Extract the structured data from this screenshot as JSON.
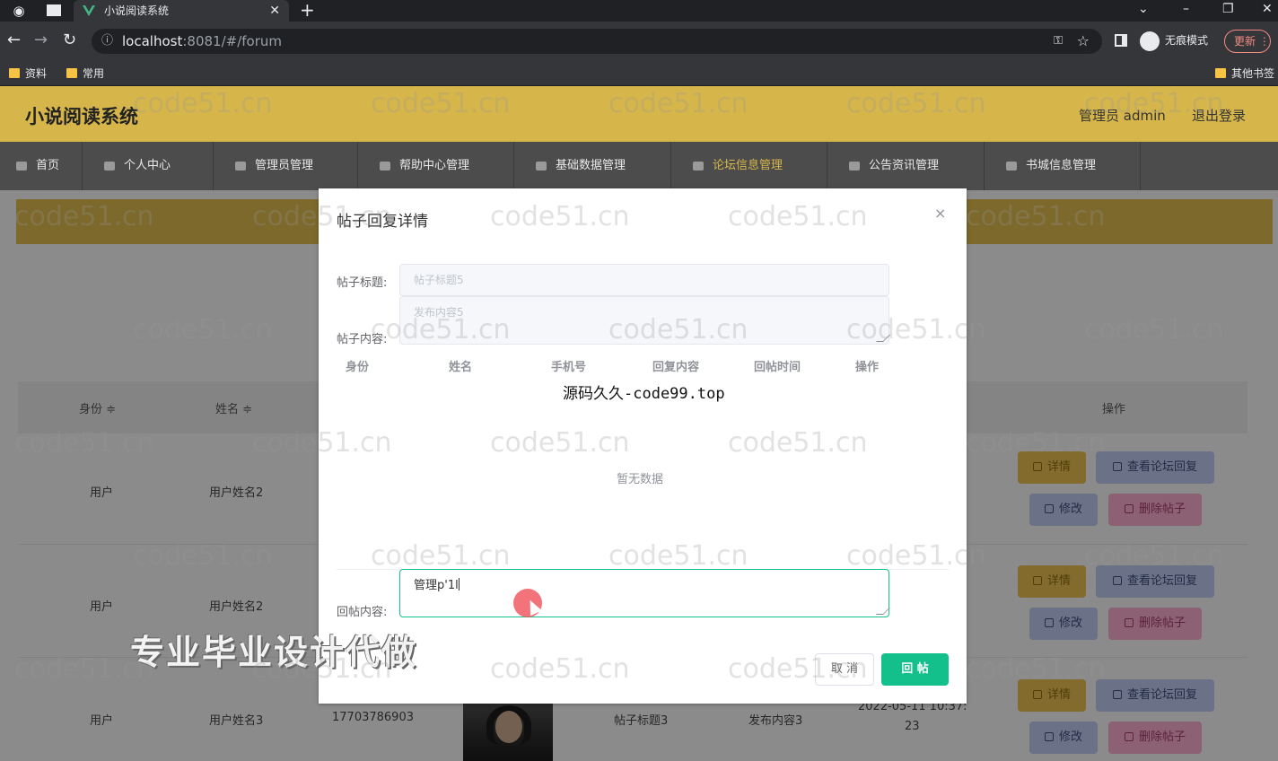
{
  "browser": {
    "tab_title": "小说阅读系统",
    "url_host": "localhost",
    "url_path": ":8081/#/forum",
    "incognito_label": "无痕模式",
    "update_label": "更新",
    "bookmarks": [
      "资料",
      "常用"
    ],
    "other_bookmarks": "其他书签"
  },
  "header": {
    "title": "小说阅读系统",
    "user": "管理员 admin",
    "logout": "退出登录"
  },
  "nav": [
    {
      "label": "首页"
    },
    {
      "label": "个人中心"
    },
    {
      "label": "管理员管理"
    },
    {
      "label": "帮助中心管理"
    },
    {
      "label": "基础数据管理"
    },
    {
      "label": "论坛信息管理"
    },
    {
      "label": "公告资讯管理"
    },
    {
      "label": "书城信息管理"
    }
  ],
  "table": {
    "headers": {
      "identity": "身份 ≑",
      "name": "姓名 ≑",
      "actions": "操作"
    },
    "rows": [
      {
        "identity": "用户",
        "name": "用户姓名2"
      },
      {
        "identity": "用户",
        "name": "用户姓名2"
      },
      {
        "identity": "用户",
        "name": "用户姓名3",
        "phone": "17703786903",
        "post_title": "帖子标题3",
        "content": "发布内容3",
        "time_line1": "2022-05-11 10:37:",
        "time_line2": "23"
      }
    ],
    "buttons": {
      "detail": "详情",
      "view_reply": "查看论坛回复",
      "edit": "修改",
      "delete": "删除帖子"
    }
  },
  "dialog": {
    "title": "帖子回复详情",
    "close": "×",
    "post_title_label": "帖子标题:",
    "post_title_value": "帖子标题5",
    "post_content_label": "帖子内容:",
    "post_content_value": "发布内容5",
    "columns": [
      "身份",
      "姓名",
      "手机号",
      "回复内容",
      "回帖时间",
      "操作"
    ],
    "overlay_text": "源码久久-code99.top",
    "empty_text": "暂无数据",
    "reply_label": "回帖内容:",
    "reply_value": "管理p'1l",
    "cancel": "取 消",
    "submit": "回 帖"
  },
  "watermark": "code51.cn",
  "promo": "专业毕业设计代做",
  "colors": {
    "accent": "#13c08b",
    "header": "#d6b64a",
    "nav": "#4c4c4c"
  }
}
